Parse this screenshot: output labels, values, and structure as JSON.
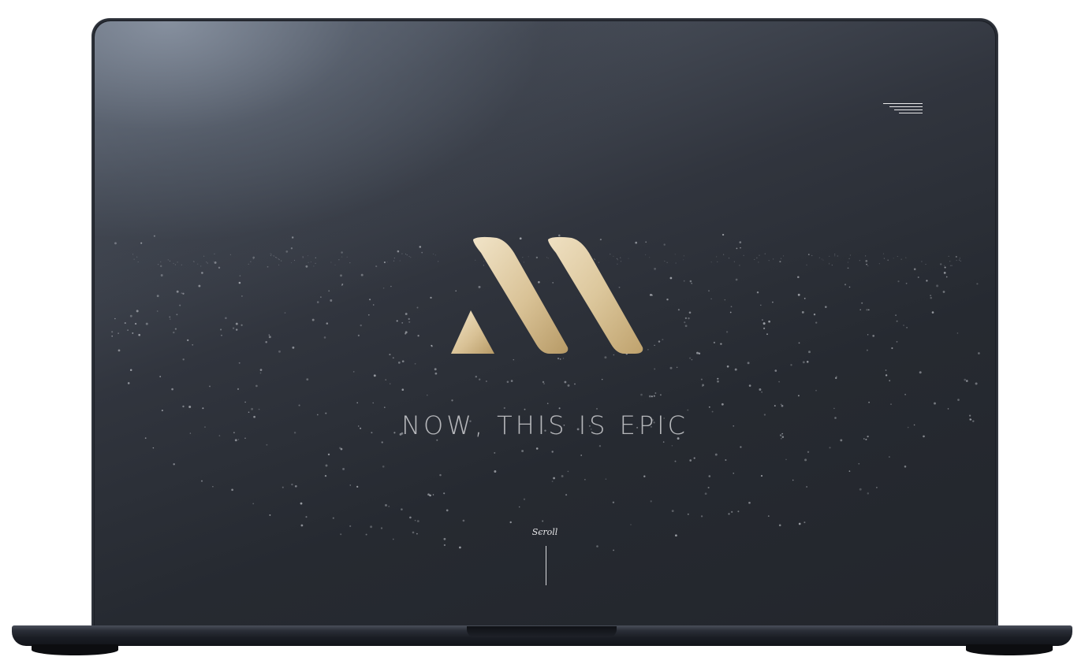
{
  "hero": {
    "tagline": "NOW, THIS IS EPIC",
    "scroll_label": "Scroll"
  },
  "icons": {
    "menu": "hamburger-menu-icon",
    "logo": "monogram-logo"
  },
  "colors": {
    "background_dark": "#23262c",
    "accent_gold": "#d4bc8e",
    "text_light": "#cfd0d3"
  }
}
